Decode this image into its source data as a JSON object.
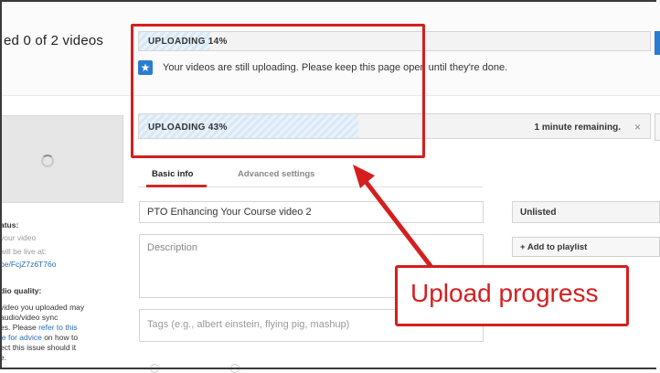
{
  "header": {
    "uploaded_title": "ed 0 of 2 videos"
  },
  "uploads": [
    {
      "label": "UPLOADING 14%",
      "progress_percent": 14
    },
    {
      "label": "UPLOADING 43%",
      "progress_percent": 43,
      "remaining": "1 minute remaining.",
      "cancel_label": "×"
    }
  ],
  "notice": {
    "icon": "star-icon",
    "text": "Your videos are still uploading. Please keep this page open until they're done."
  },
  "left_panel": {
    "status_heading": "atus:",
    "status_lines": [
      "your video",
      "will be live at:"
    ],
    "video_link": "be/FcjZ7z6T76o",
    "quality_heading": "dio quality:",
    "quality_lines": [
      "video you uploaded may",
      "audio/video sync"
    ],
    "quality_line3_pre": "es. Please ",
    "quality_line3_link": "refer to this",
    "quality_line4_link": "le for advice",
    "quality_line4_post": " on how to",
    "quality_line5": "ect this issue should it",
    "quality_line6": "e."
  },
  "tabs": [
    {
      "label": "Basic info",
      "active": true
    },
    {
      "label": "Advanced settings",
      "active": false
    }
  ],
  "form": {
    "title_value": "PTO Enhancing Your Course video 2",
    "description_placeholder": "Description",
    "tags_placeholder": "Tags (e.g., albert einstein, flying pig, mashup)",
    "privacy_value": "Unlisted",
    "add_playlist_label": "+ Add to playlist"
  },
  "annotation": {
    "callout_text": "Upload progress",
    "color": "#d41f1f"
  },
  "colors": {
    "accent_blue": "#2b7bd0",
    "tab_active": "#cc2a2a"
  }
}
